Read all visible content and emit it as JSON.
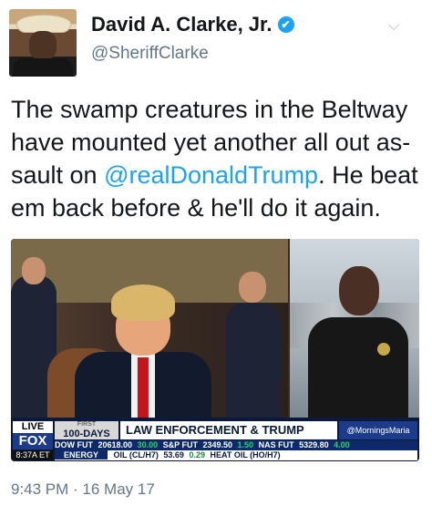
{
  "author": {
    "name": "David A. Clarke, Jr.",
    "handle": "@SheriffClarke",
    "verified_icon": "✔",
    "menu_icon": "⌵"
  },
  "tweet": {
    "text_before": "The swamp creatures in the Beltway have mounted yet another all out as- sault on ",
    "mention": "@realDonaldTrump",
    "text_after": ". He beat em back before & he'll do it again.",
    "timestamp": "9:43 PM · 16 May 17"
  },
  "broadcast": {
    "live": "LIVE",
    "logo": "FOX",
    "clock": "8:37A ET",
    "days_top": "FIRST",
    "days": "100-DAYS",
    "headline": "LAW ENFORCEMENT & TRUMP",
    "hashtag": "@MorningsMaria",
    "markets": [
      {
        "label": "DOW FUT",
        "value": "20618.00",
        "change": "30.00"
      },
      {
        "label": "S&P FUT",
        "value": "2349.50",
        "change": "1.50"
      },
      {
        "label": "NAS FUT",
        "value": "5329.80",
        "change": "4.00"
      }
    ],
    "commodity_label": "ENERGY",
    "commodities": [
      {
        "label": "OIL (CL/H7)",
        "value": "53.69",
        "change": "0.29"
      },
      {
        "label": "HEAT OIL (HO/H7)",
        "value": "",
        "change": ""
      }
    ]
  },
  "colors": {
    "link": "#1da1f2",
    "secondary_text": "#657786",
    "ticker_bg": "#0b1a3a"
  }
}
